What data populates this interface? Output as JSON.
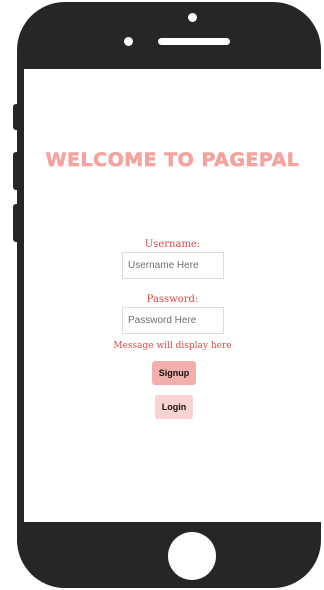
{
  "app": {
    "welcome_title": "WELCOME TO PAGEPAL"
  },
  "form": {
    "username_label": "Username:",
    "username_placeholder": "Username Here",
    "username_value": "",
    "password_label": "Password:",
    "password_placeholder": "Password Here",
    "password_value": "",
    "message": "Message will display here",
    "signup_label": "Signup",
    "login_label": "Login"
  },
  "colors": {
    "title": "#f4a39e",
    "label": "#d94b45",
    "signup_button": "#f2b0ac",
    "login_button": "#f9d3d1",
    "phone_body": "#262626"
  },
  "icons": {
    "camera": "camera-icon",
    "speaker": "speaker-icon",
    "home": "home-button-icon"
  }
}
